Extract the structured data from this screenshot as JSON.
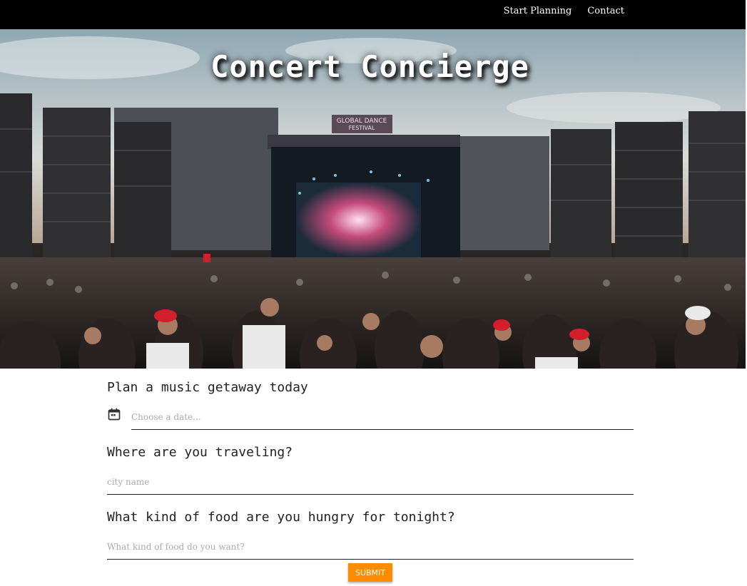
{
  "nav": {
    "links": [
      "Start Planning",
      "Contact"
    ]
  },
  "hero": {
    "title": "Concert Concierge",
    "stage_banner_line1": "GLOBAL DANCE",
    "stage_banner_line2": "FESTIVAL"
  },
  "form": {
    "heading": "Plan a music getaway today",
    "date_placeholder": "Choose a date...",
    "travel_question": "Where are you traveling?",
    "city_placeholder": "city name",
    "food_question": "What kind of food are you hungry for tonight?",
    "food_placeholder": "What kind of food do you want?",
    "submit_label": "SUBMIT"
  },
  "colors": {
    "navbar": "#000000",
    "submit": "#ff8c00"
  },
  "icons": {
    "date": "calendar-icon"
  }
}
